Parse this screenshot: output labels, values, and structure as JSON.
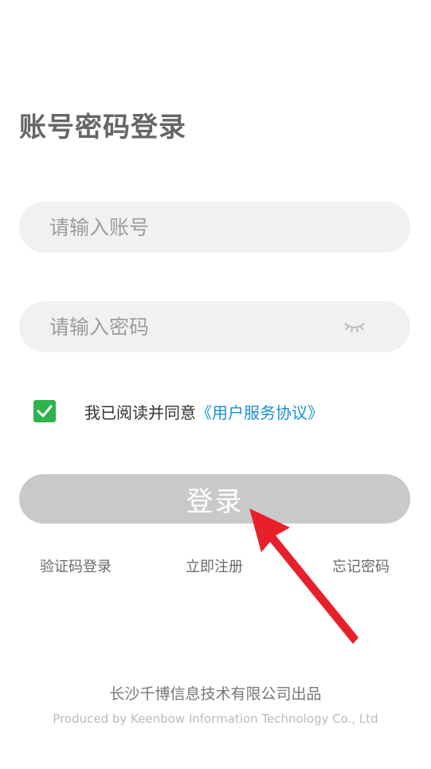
{
  "page": {
    "title": "账号密码登录"
  },
  "form": {
    "account_placeholder": "请输入账号",
    "password_placeholder": "请输入密码",
    "password_toggle_icon": "eye-closed-icon",
    "agreement": {
      "checked": true,
      "prefix": "我已阅读并同意",
      "link_text": "《用户服务协议》",
      "check_color": "#2eb34e",
      "link_color": "#1a8fd6"
    },
    "login_label": "登录"
  },
  "links": {
    "sms_login": "验证码登录",
    "register": "立即注册",
    "forgot_password": "忘记密码"
  },
  "footer": {
    "company_cn": "长沙千博信息技术有限公司出品",
    "company_en": "Produced by Keenbow Information Technology Co., Ltd"
  },
  "annotation": {
    "arrow_color": "#e8202a",
    "arrow_icon": "red-arrow-pointer"
  }
}
